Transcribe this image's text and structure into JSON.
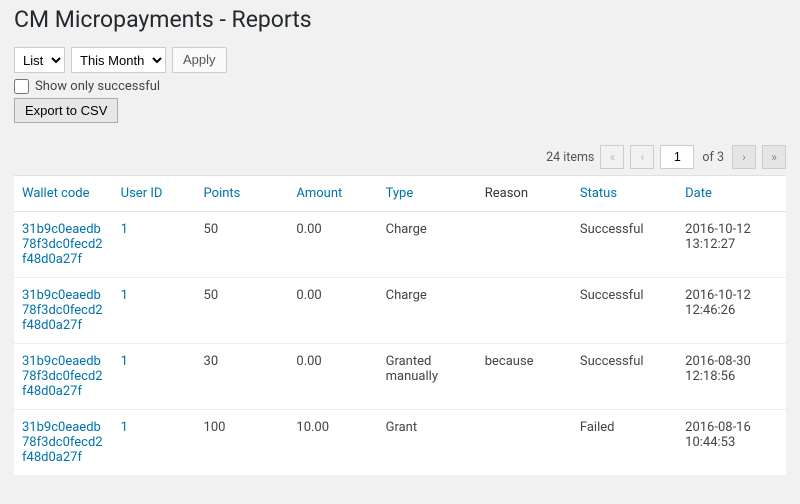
{
  "title": "CM Micropayments - Reports",
  "filters": {
    "view_options": [
      "List"
    ],
    "view_selected": "List",
    "range_options": [
      "This Month"
    ],
    "range_selected": "This Month",
    "apply_label": "Apply",
    "show_successful_label": "Show only successful",
    "show_successful_checked": false,
    "export_label": "Export to CSV"
  },
  "pagination": {
    "item_count_label": "24 items",
    "current_page": "1",
    "total_pages_label": "of 3",
    "first": "«",
    "prev": "‹",
    "next": "›",
    "last": "»"
  },
  "columns": {
    "wallet": "Wallet code",
    "user": "User ID",
    "points": "Points",
    "amount": "Amount",
    "type": "Type",
    "reason": "Reason",
    "status": "Status",
    "date": "Date"
  },
  "rows": [
    {
      "wallet": "31b9c0eaedb78f3dc0fecd2f48d0a27f",
      "user": "1",
      "points": "50",
      "amount": "0.00",
      "type": "Charge",
      "reason": "",
      "status": "Successful",
      "date": "2016-10-12 13:12:27"
    },
    {
      "wallet": "31b9c0eaedb78f3dc0fecd2f48d0a27f",
      "user": "1",
      "points": "50",
      "amount": "0.00",
      "type": "Charge",
      "reason": "",
      "status": "Successful",
      "date": "2016-10-12 12:46:26"
    },
    {
      "wallet": "31b9c0eaedb78f3dc0fecd2f48d0a27f",
      "user": "1",
      "points": "30",
      "amount": "0.00",
      "type": "Granted manually",
      "reason": "because",
      "status": "Successful",
      "date": "2016-08-30 12:18:56"
    },
    {
      "wallet": "31b9c0eaedb78f3dc0fecd2f48d0a27f",
      "user": "1",
      "points": "100",
      "amount": "10.00",
      "type": "Grant",
      "reason": "",
      "status": "Failed",
      "date": "2016-08-16 10:44:53"
    }
  ]
}
